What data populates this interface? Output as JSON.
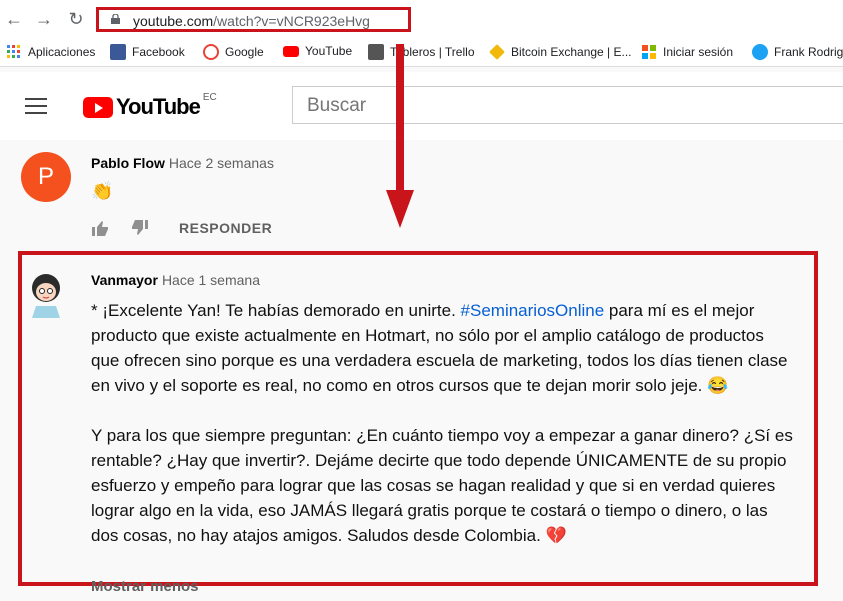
{
  "browser": {
    "url_domain": "youtube.com",
    "url_path": "/watch?v=vNCR923eHvg",
    "bookmarks": [
      {
        "label": "Aplicaciones",
        "icon": "apps-grid-icon",
        "color": "#4285f4"
      },
      {
        "label": "Facebook",
        "icon": "facebook-icon",
        "color": "#3b5998"
      },
      {
        "label": "Google",
        "icon": "google-icon",
        "color": "#ea4335"
      },
      {
        "label": "YouTube",
        "icon": "youtube-icon",
        "color": "#ff0000"
      },
      {
        "label": "Tableros | Trello",
        "icon": "trello-icon",
        "color": "#555555"
      },
      {
        "label": "Bitcoin Exchange | E...",
        "icon": "bitcoin-icon",
        "color": "#f0b90b"
      },
      {
        "label": "Iniciar sesión",
        "icon": "microsoft-icon",
        "color": "#f25022"
      },
      {
        "label": "Frank Rodrig",
        "icon": "twitter-icon",
        "color": "#1da1f2"
      }
    ]
  },
  "header": {
    "logo_text": "YouTube",
    "country": "EC",
    "search_placeholder": "Buscar"
  },
  "comments": [
    {
      "author": "Pablo Flow",
      "time": "Hace 2 semanas",
      "avatar_letter": "P",
      "text": "👏",
      "reply_label": "RESPONDER"
    },
    {
      "author": "Vanmayor",
      "time": "Hace 1 semana",
      "p1_a": "* ¡Excelente Yan! Te habías demorado en unirte. ",
      "hashtag": "#SeminariosOnline",
      "p1_b": " para mí es el mejor producto que existe actualmente en Hotmart, no sólo por el amplio catálogo de productos que ofrecen sino porque es una verdadera escuela de marketing, todos los días tienen clase en vivo y el soporte es real, no como en otros cursos que te dejan morir solo jeje. 😂",
      "p2": "Y para los que siempre preguntan: ¿En cuánto tiempo voy a empezar a ganar dinero? ¿Sí es rentable? ¿Hay que invertir?. Dejáme decirte que todo depende ÚNICAMENTE de su propio esfuerzo y empeño para lograr que las cosas se hagan realidad y que si en verdad quieres lograr algo en la vida, eso JAMÁS llegará gratis porque te costará o tiempo o dinero, o las dos cosas, no hay atajos amigos. Saludos desde Colombia. 💔",
      "show_less": "Mostrar menos"
    }
  ],
  "colors": {
    "highlight": "#c9141b",
    "hashtag": "#065fd4"
  }
}
